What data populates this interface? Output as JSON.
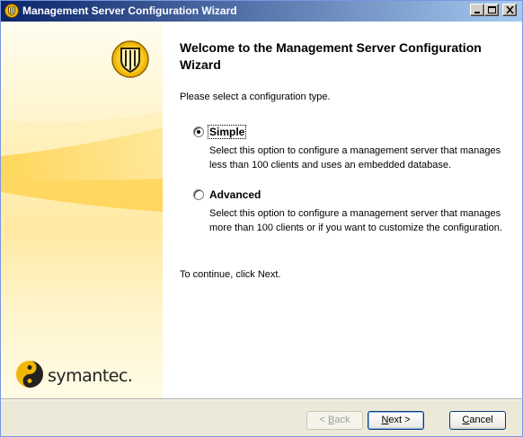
{
  "window": {
    "title": "Management Server Configuration Wizard"
  },
  "brand": {
    "name": "symantec."
  },
  "main": {
    "heading": "Welcome to the Management Server Configuration Wizard",
    "prompt": "Please select a configuration type.",
    "options": [
      {
        "label": "Simple",
        "selected": true,
        "description": "Select this option to configure a management server that manages less than 100 clients and uses an embedded database."
      },
      {
        "label": "Advanced",
        "selected": false,
        "description": "Select this option to configure a management server that manages more than 100 clients or if you want to customize the configuration."
      }
    ],
    "continue_text": "To continue, click Next."
  },
  "buttons": {
    "back": {
      "accel": "B",
      "rest": "ack",
      "prefix": "< "
    },
    "next": {
      "accel": "N",
      "rest": "ext >"
    },
    "cancel": {
      "accel": "C",
      "rest": "ancel"
    }
  },
  "colors": {
    "titlebar_start": "#0a246a",
    "titlebar_end": "#a6caf0",
    "sidebar_gold": "#ffd24a",
    "shield": "#f2b705"
  }
}
